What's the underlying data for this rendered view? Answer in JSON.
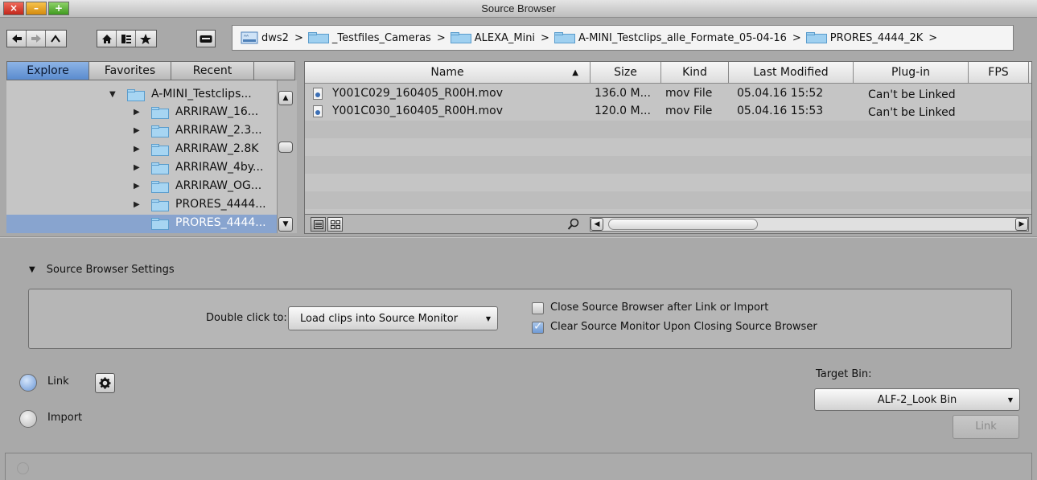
{
  "window": {
    "title": "Source Browser"
  },
  "path": {
    "crumbs": [
      "dws2",
      "_Testfiles_Cameras",
      "ALEXA_Mini",
      "A-MINI_Testclips_alle_Formate_05-04-16",
      "PRORES_4444_2K"
    ],
    "sep": ">"
  },
  "nav": {
    "tabs": [
      "Explore",
      "Favorites",
      "Recent"
    ],
    "active_tab": "Explore"
  },
  "tree": {
    "items": [
      {
        "label": "A-MINI_Testclips...",
        "expanded": true
      },
      {
        "label": "ARRIRAW_16...",
        "expanded": false
      },
      {
        "label": "ARRIRAW_2.3...",
        "expanded": false
      },
      {
        "label": "ARRIRAW_2.8K",
        "expanded": false
      },
      {
        "label": "ARRIRAW_4by...",
        "expanded": false
      },
      {
        "label": "ARRIRAW_OG...",
        "expanded": false
      },
      {
        "label": "PRORES_4444...",
        "expanded": false
      },
      {
        "label": "PRORES_4444...",
        "selected": true
      }
    ]
  },
  "table": {
    "columns": [
      "Name",
      "Size",
      "Kind",
      "Last Modified",
      "Plug-in",
      "FPS"
    ],
    "sort_indicator": "▲",
    "rows": [
      {
        "name": "Y001C029_160405_R00H.mov",
        "size": "136.0 M...",
        "kind": "mov File",
        "modified": "05.04.16 15:52",
        "plugin": "Can't be Linked"
      },
      {
        "name": "Y001C030_160405_R00H.mov",
        "size": "120.0 M...",
        "kind": "mov File",
        "modified": "05.04.16 15:53",
        "plugin": "Can't be Linked"
      }
    ]
  },
  "settings": {
    "header": "Source Browser Settings",
    "double_click_label": "Double click to:",
    "double_click_value": "Load clips into Source Monitor",
    "checkboxes": [
      {
        "label": "Close Source Browser after Link or Import",
        "checked": false
      },
      {
        "label": "Clear Source Monitor Upon Closing Source Browser",
        "checked": true
      }
    ]
  },
  "mode": {
    "link_label": "Link",
    "import_label": "Import",
    "selected": "Link"
  },
  "target": {
    "label": "Target Bin:",
    "value": "ALF-2_Look Bin",
    "button": "Link"
  },
  "colors": {
    "accent": "#5a8bce",
    "selection": "#88a4cf",
    "window_bg": "#a9a9a9"
  }
}
